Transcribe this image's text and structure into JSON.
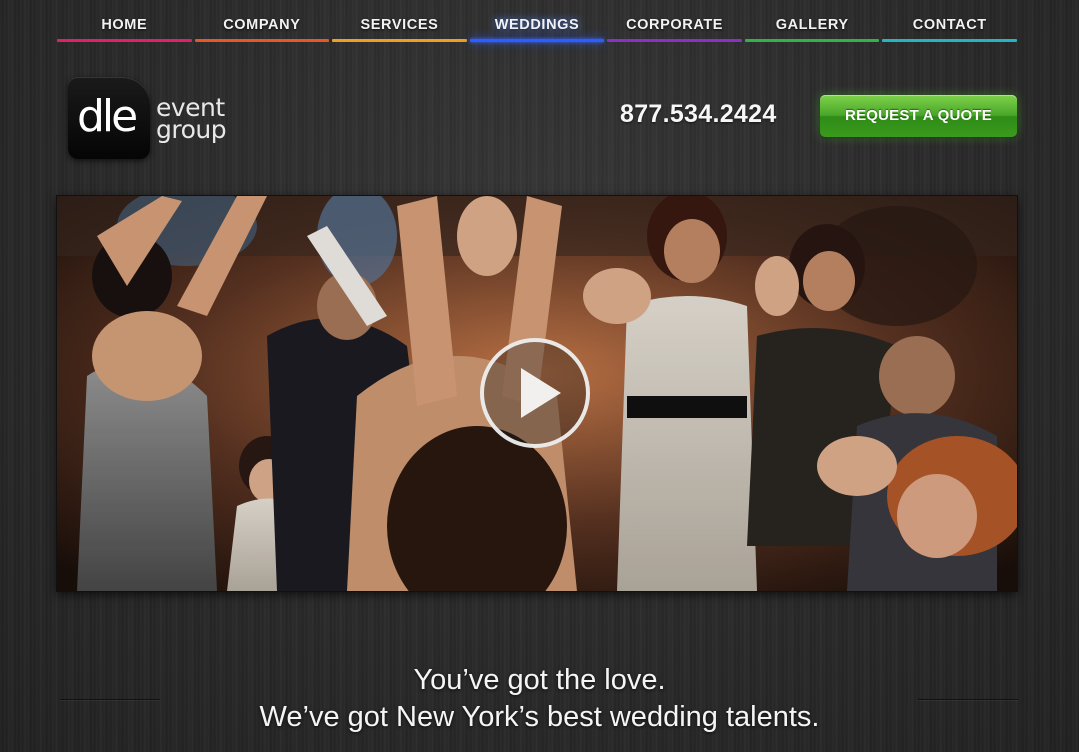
{
  "nav": {
    "items": [
      {
        "label": "HOME",
        "color": "#e0216a"
      },
      {
        "label": "COMPANY",
        "color": "#e8572a"
      },
      {
        "label": "SERVICES",
        "color": "#f0a020"
      },
      {
        "label": "WEDDINGS",
        "color": "#2f5cff",
        "active": true
      },
      {
        "label": "CORPORATE",
        "color": "#8b2fc9"
      },
      {
        "label": "GALLERY",
        "color": "#2fb34a"
      },
      {
        "label": "CONTACT",
        "color": "#25b5c2"
      }
    ]
  },
  "logo": {
    "mark": "dle",
    "word1": "event",
    "word2": "group"
  },
  "header": {
    "phone": "877.534.2424",
    "cta_label": "REQUEST A QUOTE",
    "cta_color": "#4aa72a"
  },
  "hero": {
    "play_icon": "play-icon"
  },
  "tagline": {
    "line1": "You’ve got the love.",
    "line2": "We’ve got New York’s best wedding talents."
  }
}
